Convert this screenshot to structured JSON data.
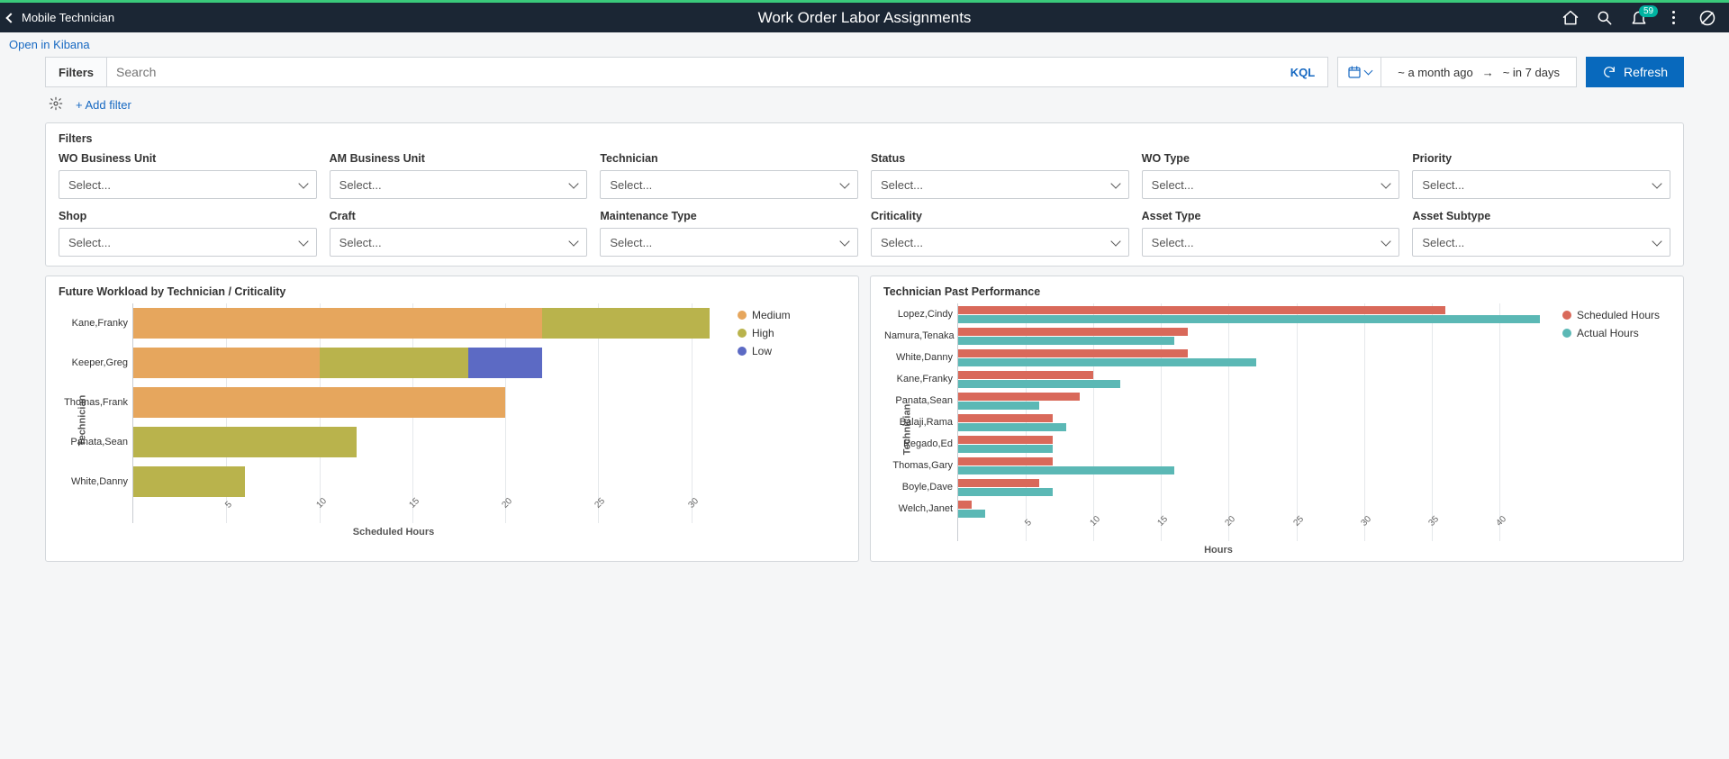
{
  "header": {
    "back_label": "Mobile Technician",
    "title": "Work Order Labor Assignments",
    "notification_count": "59"
  },
  "kibana_link": "Open in Kibana",
  "search": {
    "filters_label": "Filters",
    "placeholder": "Search",
    "kql": "KQL"
  },
  "date_range": {
    "from": "~ a month ago",
    "to": "~ in 7 days"
  },
  "refresh_label": "Refresh",
  "add_filter_label": "+ Add filter",
  "filters_panel": {
    "title": "Filters",
    "select_placeholder": "Select...",
    "fields": [
      "WO Business Unit",
      "AM Business Unit",
      "Technician",
      "Status",
      "WO Type",
      "Priority",
      "Shop",
      "Craft",
      "Maintenance Type",
      "Criticality",
      "Asset Type",
      "Asset Subtype"
    ]
  },
  "colors": {
    "medium": "#e6a65d",
    "high": "#b9b34c",
    "low": "#5c6ac4",
    "scheduled": "#d9695a",
    "actual": "#5bb8b5"
  },
  "chart_data": [
    {
      "id": "workload",
      "type": "bar",
      "orientation": "horizontal",
      "stacked": true,
      "title": "Future Workload by Technician / Criticality",
      "ylabel": "Technician",
      "xlabel": "Scheduled Hours",
      "xlim": [
        0,
        32
      ],
      "xticks": [
        5,
        10,
        15,
        20,
        25,
        30
      ],
      "categories": [
        "Kane,Franky",
        "Keeper,Greg",
        "Thomas,Frank",
        "Panata,Sean",
        "White,Danny"
      ],
      "series": [
        {
          "name": "Medium",
          "color_key": "medium",
          "values": [
            22,
            10,
            20,
            0,
            0
          ]
        },
        {
          "name": "High",
          "color_key": "high",
          "values": [
            9,
            8,
            0,
            12,
            6
          ]
        },
        {
          "name": "Low",
          "color_key": "low",
          "values": [
            0,
            4,
            0,
            0,
            0
          ]
        }
      ],
      "legend": [
        "Medium",
        "High",
        "Low"
      ]
    },
    {
      "id": "performance",
      "type": "bar",
      "orientation": "horizontal",
      "stacked": false,
      "title": "Technician Past Performance",
      "ylabel": "Technician",
      "xlabel": "Hours",
      "xlim": [
        0,
        44
      ],
      "xticks": [
        5,
        10,
        15,
        20,
        25,
        30,
        35,
        40
      ],
      "categories": [
        "Lopez,Cindy",
        "Namura,Tenaka",
        "White,Danny",
        "Kane,Franky",
        "Panata,Sean",
        "Balaji,Rama",
        "Regado,Ed",
        "Thomas,Gary",
        "Boyle,Dave",
        "Welch,Janet"
      ],
      "series": [
        {
          "name": "Scheduled Hours",
          "color_key": "scheduled",
          "values": [
            36,
            17,
            17,
            10,
            9,
            7,
            7,
            7,
            6,
            1
          ]
        },
        {
          "name": "Actual Hours",
          "color_key": "actual",
          "values": [
            43,
            16,
            22,
            12,
            6,
            8,
            7,
            16,
            7,
            2
          ]
        }
      ],
      "legend": [
        "Scheduled Hours",
        "Actual Hours"
      ]
    }
  ]
}
